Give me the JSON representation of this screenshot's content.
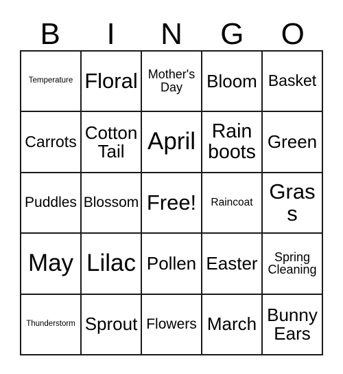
{
  "card": {
    "title": "Bingo Card",
    "header_letters": [
      "B",
      "I",
      "N",
      "G",
      "O"
    ],
    "rows": [
      [
        {
          "text": "Temperature",
          "size": "fs-xs"
        },
        {
          "text": "Floral",
          "size": "fs-xxl"
        },
        {
          "text": "Mother's Day",
          "size": "fs-sm"
        },
        {
          "text": "Bloom",
          "size": "fs-l"
        },
        {
          "text": "Basket",
          "size": "fs-ml"
        }
      ],
      [
        {
          "text": "Carrots",
          "size": "fs-ml"
        },
        {
          "text": "Cotton Tail",
          "size": "fs-l"
        },
        {
          "text": "April",
          "size": "fs-max"
        },
        {
          "text": "Rain boots",
          "size": "fs-xl"
        },
        {
          "text": "Green",
          "size": "fs-l"
        }
      ],
      [
        {
          "text": "Puddles",
          "size": "fs-m"
        },
        {
          "text": "Blossom",
          "size": "fs-m"
        },
        {
          "text": "Free!",
          "size": "fs-xxl"
        },
        {
          "text": "Raincoat",
          "size": "fs-s"
        },
        {
          "text": "Grass",
          "size": "fs-xxl"
        }
      ],
      [
        {
          "text": "May",
          "size": "fs-max"
        },
        {
          "text": "Lilac",
          "size": "fs-max"
        },
        {
          "text": "Pollen",
          "size": "fs-l"
        },
        {
          "text": "Easter",
          "size": "fs-l"
        },
        {
          "text": "Spring Cleaning",
          "size": "fs-sm"
        }
      ],
      [
        {
          "text": "Thunderstorm",
          "size": "fs-xs"
        },
        {
          "text": "Sprout",
          "size": "fs-l"
        },
        {
          "text": "Flowers",
          "size": "fs-m"
        },
        {
          "text": "March",
          "size": "fs-l"
        },
        {
          "text": "Bunny Ears",
          "size": "fs-l"
        }
      ]
    ],
    "free_space": {
      "row": 2,
      "col": 2,
      "label": "Free!"
    },
    "colors": {
      "text": "#000000",
      "border": "#1a1a1a",
      "background": "#ffffff"
    }
  }
}
